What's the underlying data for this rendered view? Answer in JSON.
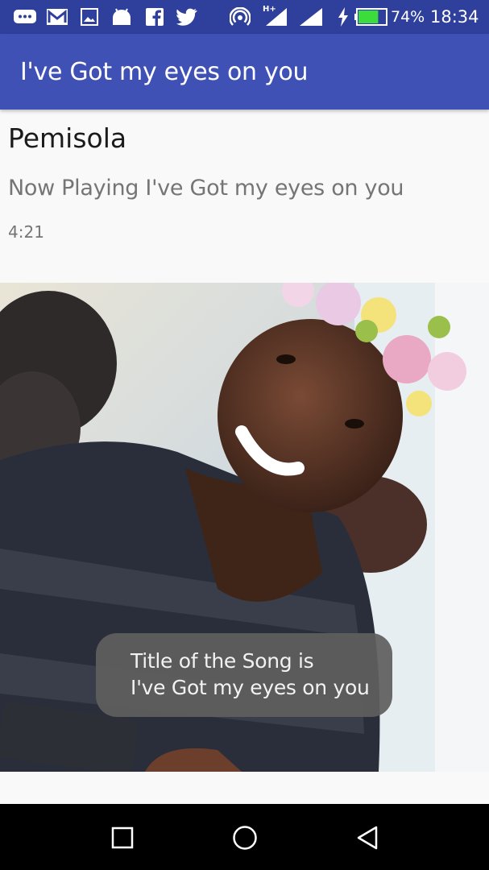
{
  "status_bar": {
    "battery_percent": "74%",
    "time": "18:34",
    "icons": [
      "messaging-icon",
      "gmail-icon",
      "gallery-icon",
      "android-icon",
      "facebook-icon",
      "twitter-icon",
      "hotspot-icon",
      "signal-hplus-icon",
      "signal-icon",
      "charging-icon",
      "battery-icon"
    ],
    "battery_level": 0.74,
    "battery_color": "#3ddc3d"
  },
  "app_bar": {
    "title": "I've Got my eyes on you",
    "color": "#3f51b5"
  },
  "content": {
    "artist": "Pemisola",
    "now_playing": "Now Playing I've Got my eyes on you",
    "duration": "4:21"
  },
  "toast": {
    "line1": "Title of the Song is",
    "line2": "I've Got my eyes on you"
  },
  "nav_bar": {
    "buttons": [
      "recent-apps-icon",
      "home-icon",
      "back-icon"
    ]
  }
}
